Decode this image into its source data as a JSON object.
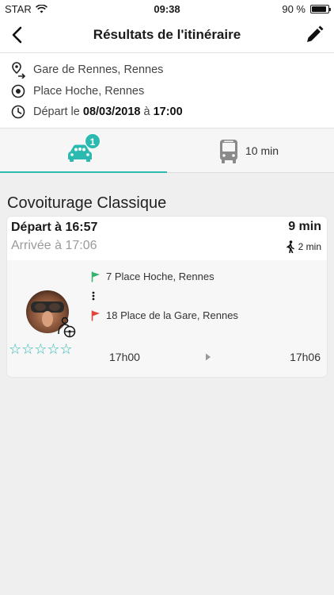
{
  "status_bar": {
    "carrier": "STAR",
    "time": "09:38",
    "battery": "90 %",
    "battery_level": 0.9
  },
  "nav": {
    "title": "Résultats de l'itinéraire",
    "back_icon": "chevron-left-icon",
    "edit_icon": "pencil-icon"
  },
  "route": {
    "origin": "Gare de Rennes, Rennes",
    "destination": "Place Hoche, Rennes",
    "depart_prefix": "Départ le",
    "depart_date": "08/03/2018",
    "depart_sep": "à",
    "depart_time": "17:00"
  },
  "tabs": {
    "covoit_badge": "1",
    "bus_time": "10 min"
  },
  "section_title": "Covoiturage Classique",
  "result": {
    "depart_label": "Départ à",
    "depart_time": "16:57",
    "arrive_label": "Arrivée à",
    "arrive_time": "17:06",
    "duration": "9 min",
    "walk_time": "2 min",
    "stop_from": "7 Place Hoche, Rennes",
    "stop_to": "18 Place de la Gare, Rennes",
    "time_start": "17h00",
    "time_end": "17h06",
    "rating": "☆☆☆☆☆"
  },
  "colors": {
    "accent": "#2cb9b0",
    "flag_green": "#33b36b",
    "flag_red": "#e0453c"
  }
}
